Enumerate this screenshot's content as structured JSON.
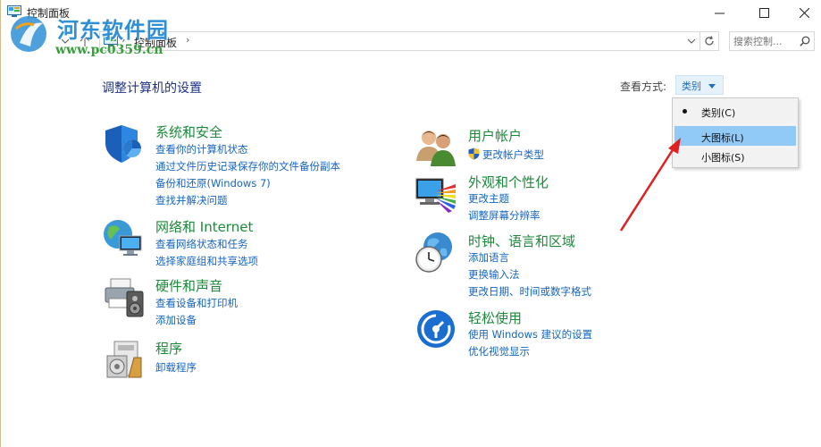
{
  "window": {
    "title": "控制面板"
  },
  "address": {
    "path": "控制面板",
    "search_placeholder": "搜索控制..."
  },
  "watermark": {
    "name": "河东软件园",
    "url": "www.pc0359.cn"
  },
  "header": {
    "title": "调整计算机的设置",
    "view_label": "查看方式:",
    "view_value": "类别"
  },
  "view_menu": {
    "items": [
      {
        "label": "类别(C)",
        "selected": true
      },
      {
        "label": "大图标(L)",
        "highlighted": true
      },
      {
        "label": "小图标(S)"
      }
    ]
  },
  "categories": {
    "system": {
      "title": "系统和安全",
      "links": [
        "查看你的计算机状态",
        "通过文件历史记录保存你的文件备份副本",
        "备份和还原(Windows 7)",
        "查找并解决问题"
      ]
    },
    "network": {
      "title": "网络和 Internet",
      "links": [
        "查看网络状态和任务",
        "选择家庭组和共享选项"
      ]
    },
    "hardware": {
      "title": "硬件和声音",
      "links": [
        "查看设备和打印机",
        "添加设备"
      ]
    },
    "programs": {
      "title": "程序",
      "links": [
        "卸载程序"
      ]
    },
    "users": {
      "title": "用户帐户",
      "links": [
        "更改帐户类型"
      ]
    },
    "appearance": {
      "title": "外观和个性化",
      "links": [
        "更改主题",
        "调整屏幕分辨率"
      ]
    },
    "clock": {
      "title": "时钟、语言和区域",
      "links": [
        "添加语言",
        "更换输入法",
        "更改日期、时间或数字格式"
      ]
    },
    "ease": {
      "title": "轻松使用",
      "links": [
        "使用 Windows 建议的设置",
        "优化视觉显示"
      ]
    }
  },
  "colors": {
    "accent": "#1565c0",
    "category_title": "#1b8a3a",
    "page_title": "#1e3287",
    "menu_highlight": "#91c9f7",
    "annotation_arrow": "#e02020"
  }
}
